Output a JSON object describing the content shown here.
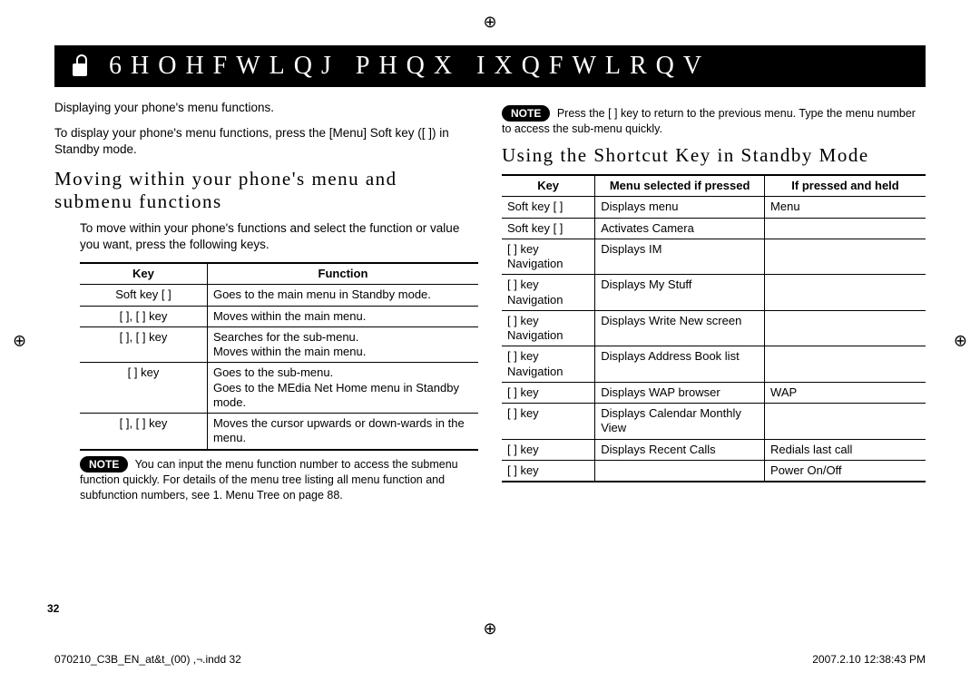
{
  "header": {
    "title": "6HOHFWLQJ PHQX IXQFWLRQV"
  },
  "left": {
    "intro1": "Displaying your phone's menu functions.",
    "intro2": "To display your phone's menu functions, press the [Menu] Soft key ([  ]) in Standby mode.",
    "subhead": "Moving within your phone's menu and submenu functions",
    "intro3": "To move within your phone's functions and select the function or value you want, press the following keys.",
    "table": {
      "h1": "Key",
      "h2": "Function",
      "rows": [
        {
          "k": "Soft key [  ]",
          "f": "Goes to the main menu in Standby mode."
        },
        {
          "k": "[  ], [  ] key",
          "f": "Moves within the main menu."
        },
        {
          "k": "[  ], [  ] key",
          "f": "Searches for the sub-menu.\nMoves within the main menu."
        },
        {
          "k": "[    ] key",
          "f": "Goes to the sub-menu.\nGoes to the MEdia Net Home menu in Standby mode."
        },
        {
          "k": "[ ], [ ] key",
          "f": "Moves the cursor upwards or down-wards in the menu."
        }
      ]
    },
    "note_label": "NOTE",
    "note": " You can input the menu function number to access the submenu function quickly. For details of the menu tree listing all menu function and subfunction numbers, see 1. Menu Tree on page 88."
  },
  "right": {
    "note_label": "NOTE",
    "note": " Press the [  ] key to return to the previous menu. Type the menu number to access the sub-menu quickly.",
    "subhead": "Using the Shortcut Key in Standby Mode",
    "table": {
      "h1": "Key",
      "h2": "Menu selected if pressed",
      "h3": "If pressed and held",
      "rows": [
        {
          "k": "Soft key [  ]",
          "m": "Displays menu",
          "p": "Menu"
        },
        {
          "k": "Soft key [  ]",
          "m": "Activates Camera",
          "p": ""
        },
        {
          "k": "[  ] key Navigation",
          "m": "Displays IM",
          "p": ""
        },
        {
          "k": "[  ] key Navigation",
          "m": "Displays My Stuff",
          "p": ""
        },
        {
          "k": "[  ] key Navigation",
          "m": "Displays Write New screen",
          "p": ""
        },
        {
          "k": "[  ] key Navigation",
          "m": "Displays Address Book list",
          "p": ""
        },
        {
          "k": "[    ] key",
          "m": "Displays WAP browser",
          "p": "WAP"
        },
        {
          "k": "[  ] key",
          "m": "Displays Calendar Monthly View",
          "p": ""
        },
        {
          "k": "[  ] key",
          "m": "Displays Recent Calls",
          "p": "Redials last call"
        },
        {
          "k": "[  ] key",
          "m": "",
          "p": "Power On/Off"
        }
      ]
    }
  },
  "page_number": "32",
  "footer": {
    "left": "070210_C3B_EN_at&t_(00) ,¬.indd   32",
    "right": "2007.2.10   12:38:43 PM"
  }
}
